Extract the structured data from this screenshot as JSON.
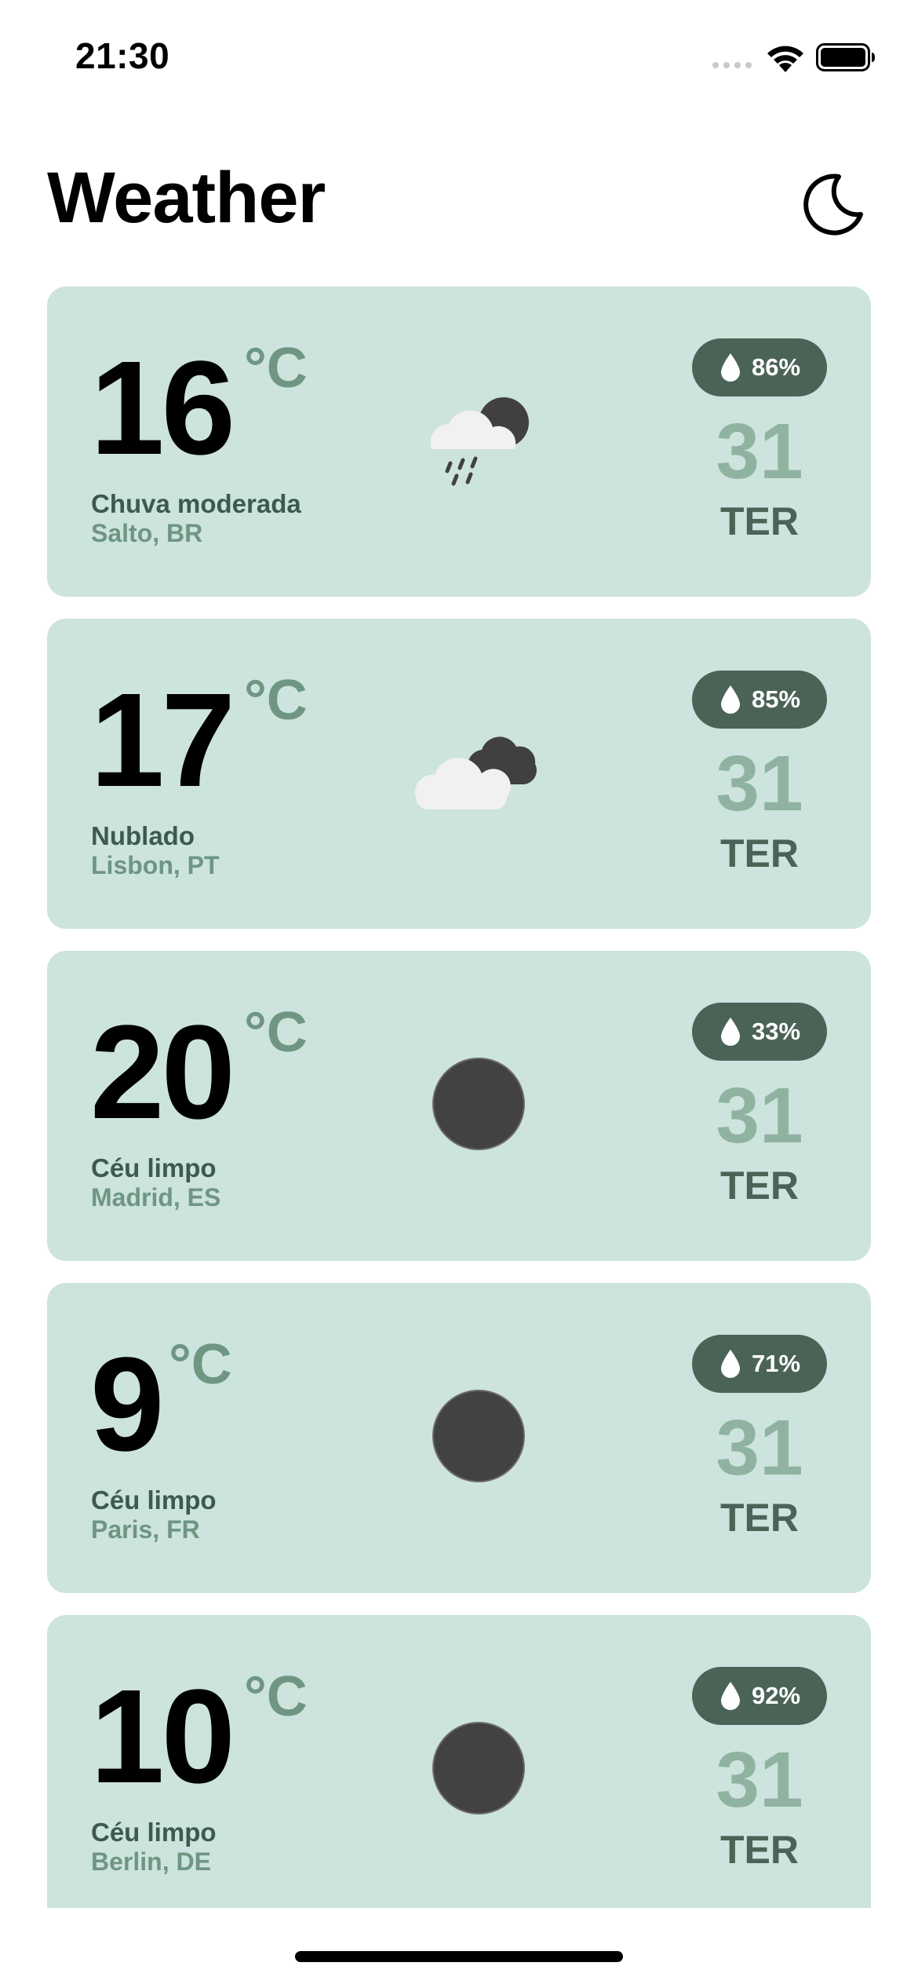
{
  "status_bar": {
    "time": "21:30"
  },
  "header": {
    "title": "Weather",
    "theme_toggle_icon": "moon-icon"
  },
  "colors": {
    "card_background": "#cde3dd",
    "accent_dark": "#4b6357",
    "accent_light": "#8fb3a0",
    "unit_color": "#6e9683"
  },
  "cards": [
    {
      "temperature": "16",
      "unit": "°C",
      "condition": "Chuva moderada",
      "location": "Salto, BR",
      "humidity": "86%",
      "day_number": "31",
      "day_name": "TER",
      "icon": "cloud-rain-moon-icon"
    },
    {
      "temperature": "17",
      "unit": "°C",
      "condition": "Nublado",
      "location": "Lisbon, PT",
      "humidity": "85%",
      "day_number": "31",
      "day_name": "TER",
      "icon": "cloudy-icon"
    },
    {
      "temperature": "20",
      "unit": "°C",
      "condition": "Céu limpo",
      "location": "Madrid, ES",
      "humidity": "33%",
      "day_number": "31",
      "day_name": "TER",
      "icon": "clear-night-icon"
    },
    {
      "temperature": "9",
      "unit": "°C",
      "condition": "Céu limpo",
      "location": "Paris, FR",
      "humidity": "71%",
      "day_number": "31",
      "day_name": "TER",
      "icon": "clear-night-icon"
    },
    {
      "temperature": "10",
      "unit": "°C",
      "condition": "Céu limpo",
      "location": "Berlin, DE",
      "humidity": "92%",
      "day_number": "31",
      "day_name": "TER",
      "icon": "clear-night-icon"
    }
  ]
}
